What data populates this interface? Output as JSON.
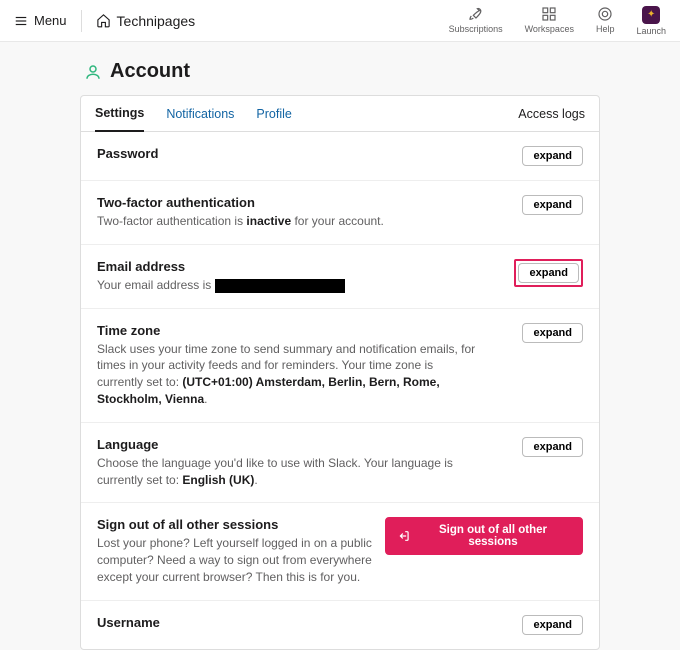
{
  "topbar": {
    "menu": "Menu",
    "site": "Technipages",
    "icons": {
      "subscriptions": "Subscriptions",
      "workspaces": "Workspaces",
      "help": "Help",
      "launch": "Launch"
    }
  },
  "page": {
    "title": "Account"
  },
  "tabs": {
    "settings": "Settings",
    "notifications": "Notifications",
    "profile": "Profile",
    "access_logs": "Access logs"
  },
  "buttons": {
    "expand": "expand"
  },
  "sections": {
    "password": {
      "title": "Password"
    },
    "twofa": {
      "title": "Two-factor authentication",
      "desc_pre": "Two-factor authentication is ",
      "desc_bold": "inactive",
      "desc_post": " for your account."
    },
    "email": {
      "title": "Email address",
      "desc_pre": "Your email address is "
    },
    "timezone": {
      "title": "Time zone",
      "desc_pre": "Slack uses your time zone to send summary and notification emails, for times in your activity feeds and for reminders. Your time zone is currently set to: ",
      "desc_bold": "(UTC+01:00) Amsterdam, Berlin, Bern, Rome, Stockholm, Vienna",
      "desc_post": "."
    },
    "language": {
      "title": "Language",
      "desc_pre": "Choose the language you'd like to use with Slack. Your language is currently set to: ",
      "desc_bold": "English (UK)",
      "desc_post": "."
    },
    "signout": {
      "title": "Sign out of all other sessions",
      "desc": "Lost your phone? Left yourself logged in on a public computer? Need a way to sign out from everywhere except your current browser? Then this is for you.",
      "button": "Sign out of all other sessions"
    },
    "username": {
      "title": "Username"
    }
  }
}
